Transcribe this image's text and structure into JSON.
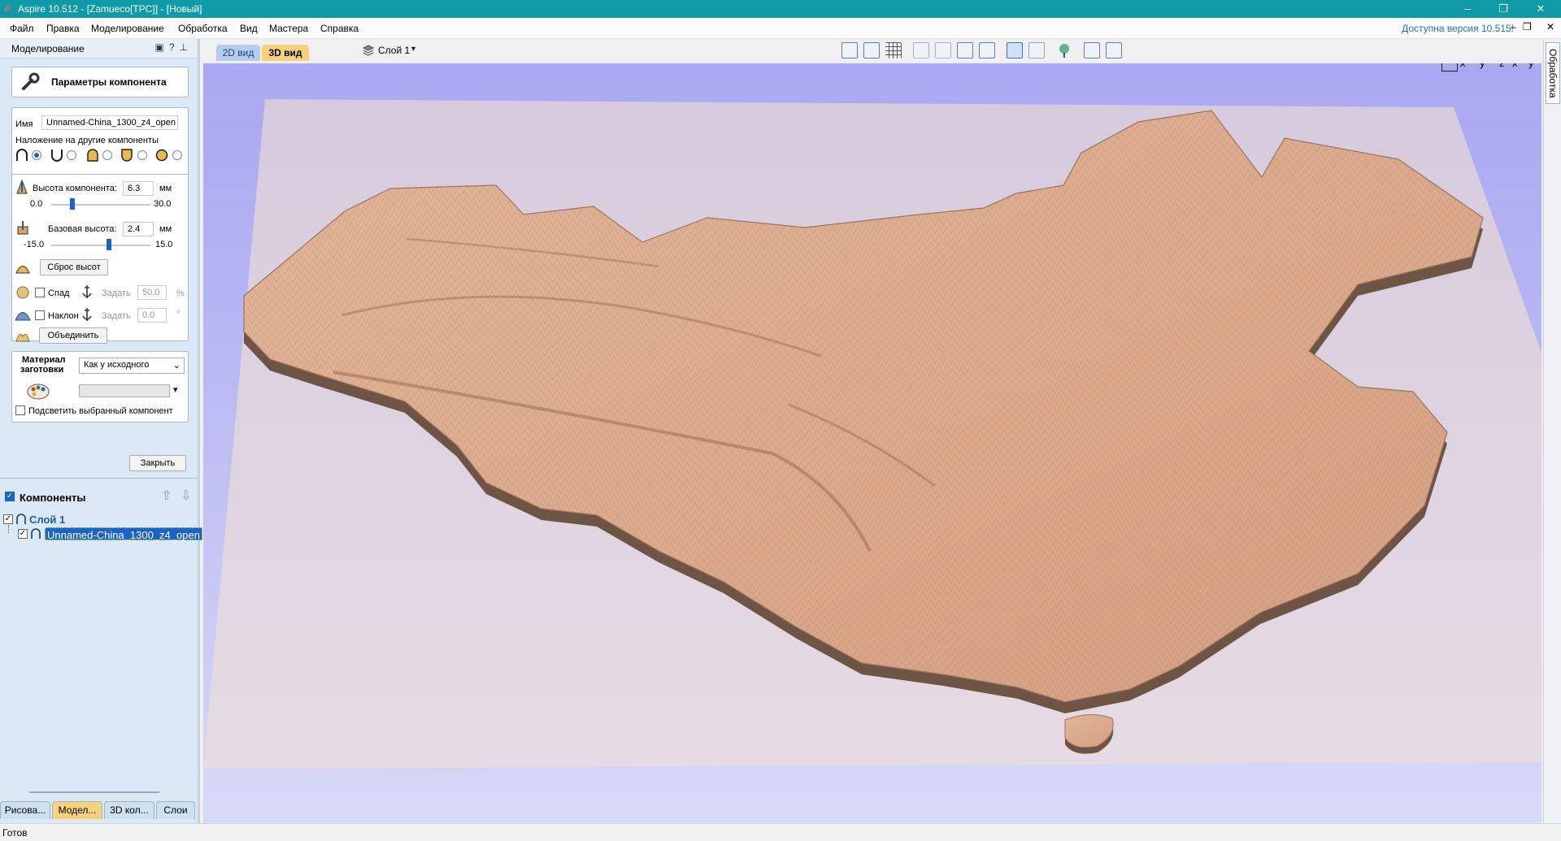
{
  "window": {
    "title": "Aspire 10.512 - [Zamueco[TPC]] - [Новый]",
    "min": "–",
    "max": "❐",
    "close": "✕"
  },
  "menu": {
    "items": [
      "Файл",
      "Правка",
      "Моделирование",
      "Обработка",
      "Вид",
      "Мастера",
      "Справка"
    ],
    "update_notice": "Доступна версия 10.515!",
    "mdi_min": "–",
    "mdi_restore": "❐",
    "mdi_close": "✕"
  },
  "panel": {
    "title": "Моделирование",
    "header_title": "Параметры компонента",
    "name_label": "Имя",
    "name_value": "Unnamed-China_1300_z4_open",
    "overlap_label": "Наложение на другие компоненты",
    "height_label": "Высота компонента:",
    "height_value": "6.3",
    "height_unit": "мм",
    "height_min": "0.0",
    "height_max": "30.0",
    "height_fraction": 0.21,
    "base_label": "Базовая высота:",
    "base_value": "2.4",
    "base_unit": "мм",
    "base_min": "-15.0",
    "base_max": "15.0",
    "base_fraction": 0.58,
    "reset_button": "Сброс высот",
    "fade_label": "Спад",
    "fade_set": "Задать",
    "fade_value": "50.0",
    "fade_unit": "%",
    "tilt_label": "Наклон",
    "tilt_set": "Задать",
    "tilt_value": "0.0",
    "tilt_unit": "°",
    "merge_button": "Объединить",
    "material_label_1": "Материал",
    "material_label_2": "заготовки",
    "material_select": "Как у исходного",
    "highlight_label": "Подсветить выбранный компонент",
    "close_button": "Закрыть"
  },
  "components": {
    "title": "Компоненты",
    "layer": "Слой 1",
    "item": "Unnamed-China_1300_z4_open"
  },
  "bottom_tabs": [
    "Рисова...",
    "Модел...",
    "3D кол...",
    "Слои"
  ],
  "view_tabs": [
    "2D вид",
    "3D вид"
  ],
  "layer_dropdown": "Слой 1",
  "right_tab": "Обработка",
  "view_axes": [
    "x",
    "y",
    "z",
    "x",
    "y"
  ],
  "status": "Готов"
}
